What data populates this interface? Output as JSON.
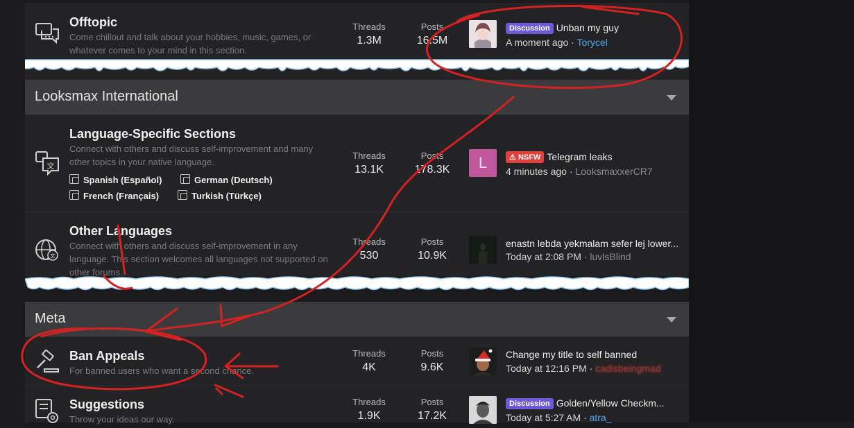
{
  "stats_labels": {
    "threads": "Threads",
    "posts": "Posts"
  },
  "categories": [
    {
      "title": "Looksmax International"
    },
    {
      "title": "Meta"
    }
  ],
  "forums": {
    "offtopic": {
      "title": "Offtopic",
      "desc": "Come chillout and talk about your hobbies, music, games, or whatever comes to your mind in this section.",
      "threads": "1.3M",
      "posts": "16.5M",
      "badge": "Discussion",
      "latest_title": "Unban my guy",
      "latest_time": "A moment ago",
      "latest_user": "Torycel"
    },
    "language": {
      "title": "Language-Specific Sections",
      "desc": "Connect with others and discuss self-improvement and many other topics in your native language.",
      "threads": "13.1K",
      "posts": "178.3K",
      "avatar_letter": "L",
      "badge": "NSFW",
      "latest_title": "Telegram leaks",
      "latest_time": "4 minutes ago",
      "latest_user": "LooksmaxxerCR7",
      "subforums": [
        "Spanish (Español)",
        "German (Deutsch)",
        "French (Français)",
        "Turkish (Türkçe)"
      ]
    },
    "other_languages": {
      "title": "Other Languages",
      "desc": "Connect with others and discuss self-improvement in any language. This section welcomes all languages not supported on other forums.",
      "threads": "530",
      "posts": "10.9K",
      "latest_title": "enastn lebda yekmalam sefer lej lower...",
      "latest_time": "Today at 2:08 PM",
      "latest_user": "luvlsBlind"
    },
    "ban_appeals": {
      "title": "Ban Appeals",
      "desc": "For banned users who want a second chance.",
      "threads": "4K",
      "posts": "9.6K",
      "latest_title": "Change my title to self banned",
      "latest_time": "Today at 12:16 PM",
      "latest_user": "cadisbeingmad"
    },
    "suggestions": {
      "title": "Suggestions",
      "desc": "Throw your ideas our way.",
      "threads": "1.9K",
      "posts": "17.2K",
      "badge": "Discussion",
      "latest_title": "Golden/Yellow Checkm...",
      "latest_time": "Today at 5:27 AM",
      "latest_user": "atra_"
    }
  },
  "separator": "·",
  "colors": {
    "accent_purple": "#6e5ad8",
    "nsfw_red": "#e2403c",
    "link_blue": "#4ea6ee",
    "annotation_red": "#d42222"
  }
}
